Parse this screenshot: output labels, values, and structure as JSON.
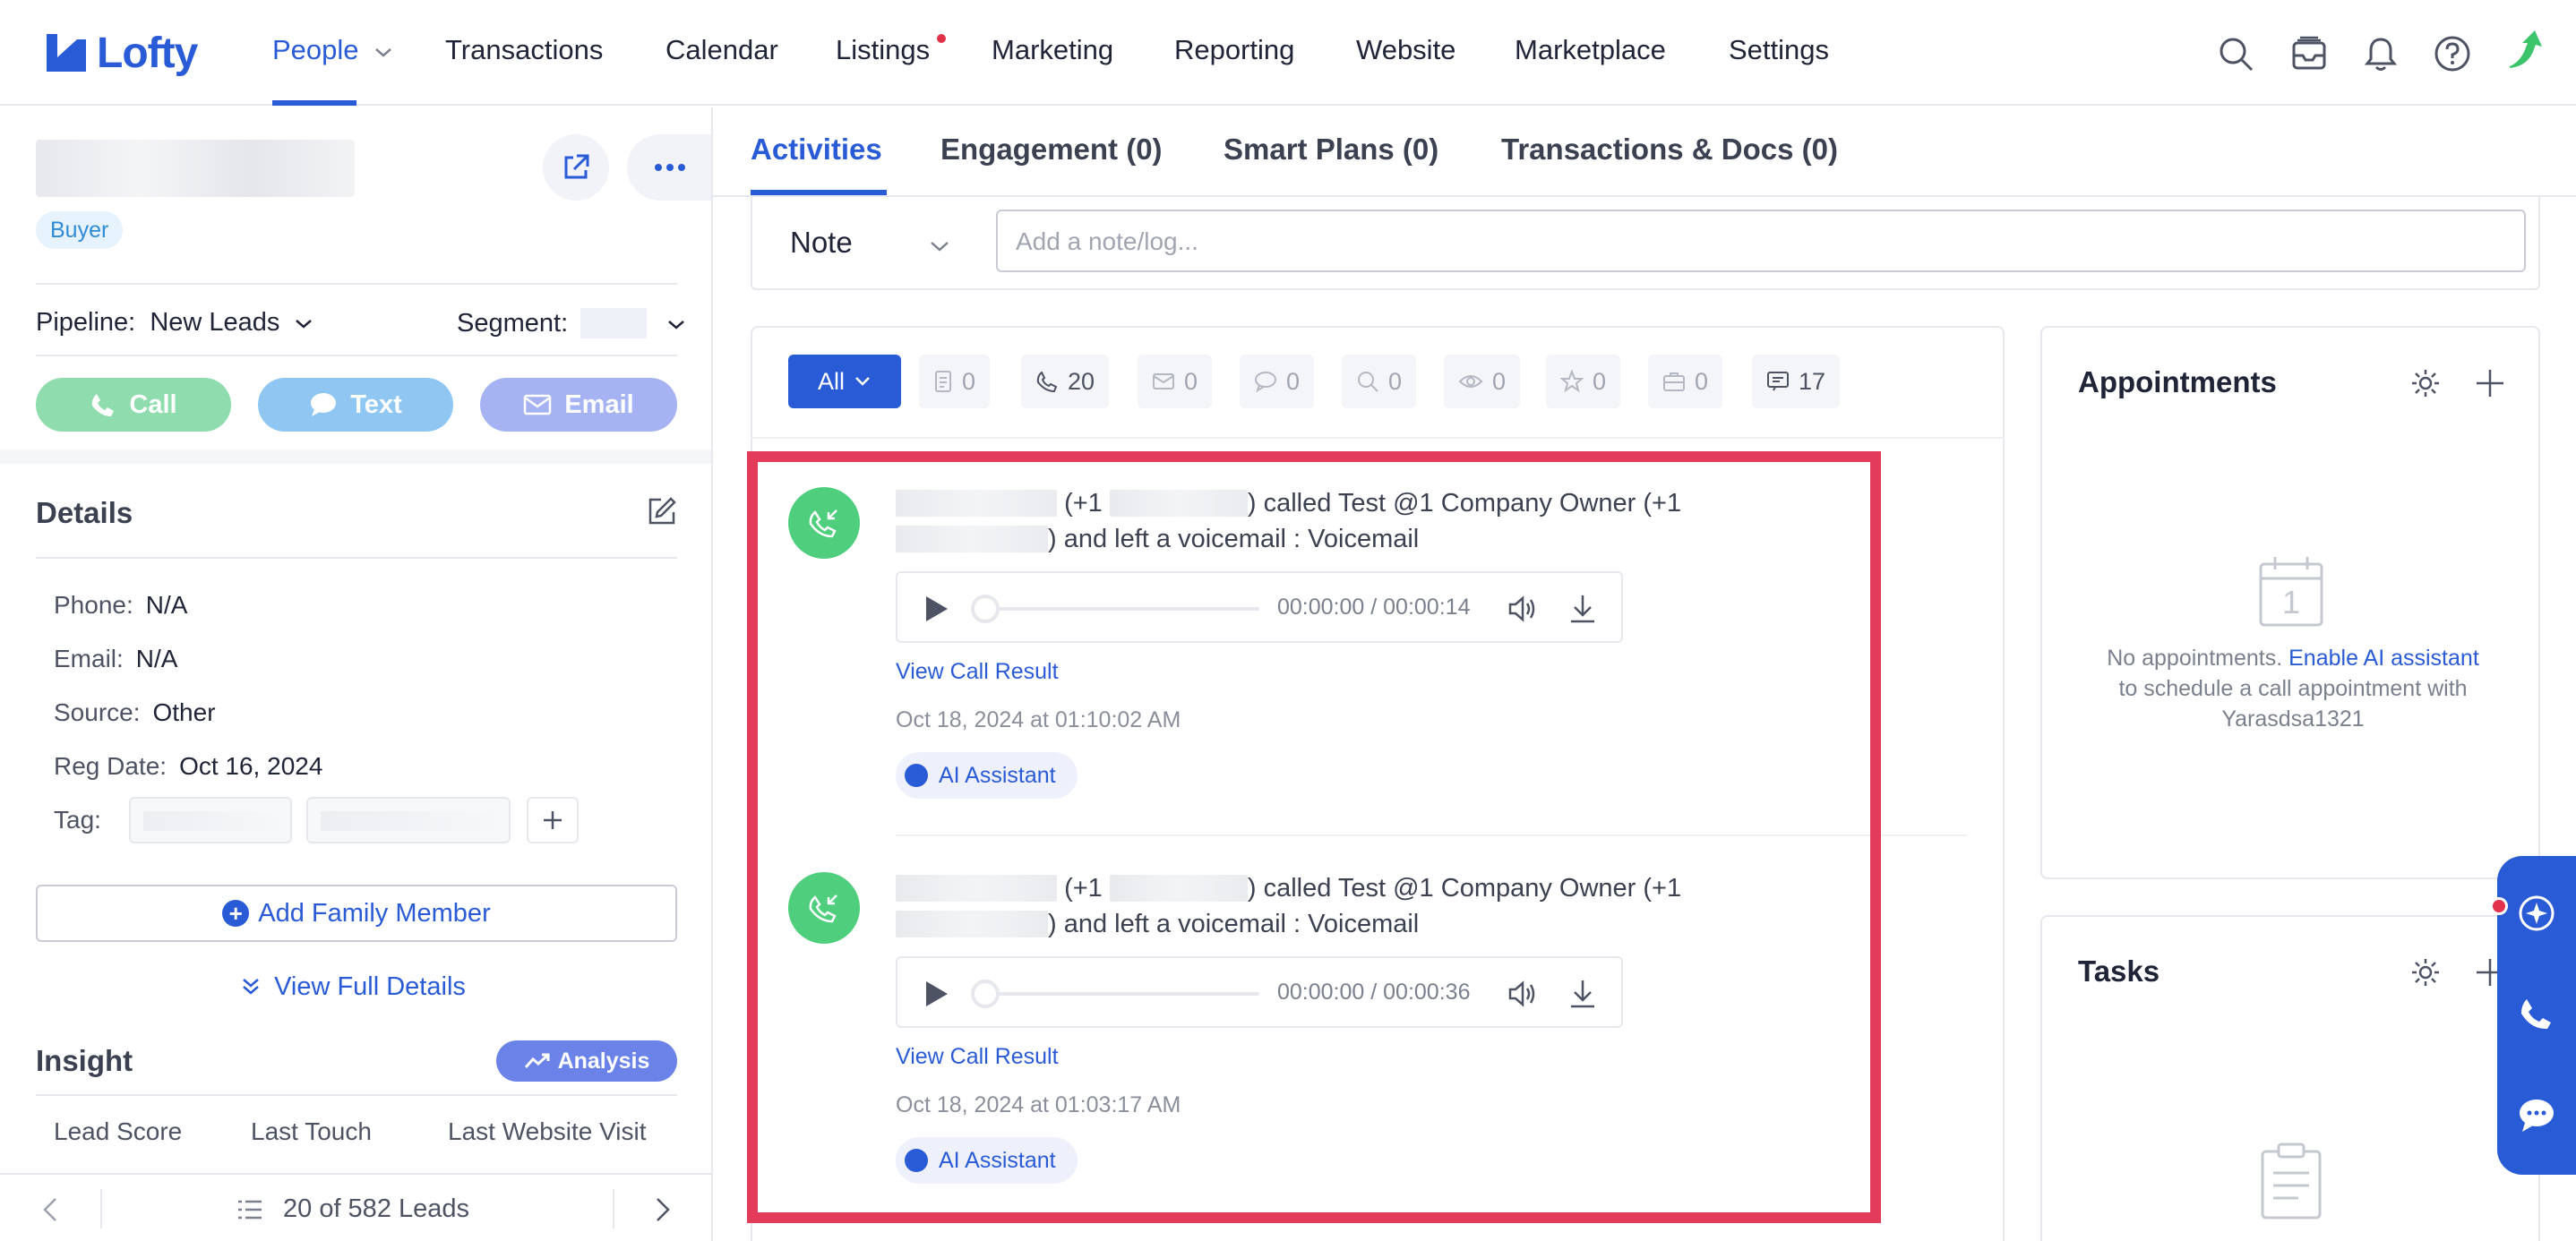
{
  "app": {
    "logo_text": "Lofty"
  },
  "nav": {
    "items": [
      "People",
      "Transactions",
      "Calendar",
      "Listings",
      "Marketing",
      "Reporting",
      "Website",
      "Marketplace",
      "Settings"
    ],
    "active": "People"
  },
  "lead": {
    "role_tag": "Buyer",
    "pipeline_label": "Pipeline:",
    "pipeline_value": "New Leads",
    "segment_label": "Segment:",
    "call_label": "Call",
    "text_label": "Text",
    "email_label": "Email"
  },
  "details": {
    "title": "Details",
    "phone_label": "Phone:",
    "phone_value": "N/A",
    "email_label": "Email:",
    "email_value": "N/A",
    "source_label": "Source:",
    "source_value": "Other",
    "reg_label": "Reg Date:",
    "reg_value": "Oct 16, 2024",
    "tag_label": "Tag:",
    "add_family": "Add Family Member",
    "view_full": "View Full Details"
  },
  "insight": {
    "title": "Insight",
    "analysis": "Analysis",
    "col1": "Lead Score",
    "col2": "Last Touch",
    "col3": "Last Website Visit"
  },
  "pager": {
    "text": "20 of 582 Leads"
  },
  "tabs": [
    "Activities",
    "Engagement (0)",
    "Smart Plans (0)",
    "Transactions & Docs (0)"
  ],
  "note": {
    "type": "Note",
    "placeholder": "Add a note/log..."
  },
  "filters": {
    "all": "All",
    "counts": [
      "0",
      "20",
      "0",
      "0",
      "0",
      "0",
      "0",
      "0",
      "17"
    ]
  },
  "activities": [
    {
      "prefix": "(+1",
      "middle": ") called Test @1 Company Owner (+1",
      "line2": ") and left a voicemail : Voicemail",
      "time": "00:00:00 / 00:00:14",
      "link": "View Call Result",
      "timestamp": "Oct 18, 2024 at 01:10:02 AM",
      "badge": "AI Assistant"
    },
    {
      "prefix": "(+1",
      "middle": ") called Test @1 Company Owner (+1",
      "line2": ") and left a voicemail : Voicemail",
      "time": "00:00:00 / 00:00:36",
      "link": "View Call Result",
      "timestamp": "Oct 18, 2024 at 01:03:17 AM",
      "badge": "AI Assistant"
    }
  ],
  "appointments": {
    "title": "Appointments",
    "calendar_day": "1",
    "msg_pre": "No appointments.",
    "msg_link": "Enable AI assistant",
    "msg_post": "to schedule a call appointment with Yarasdsa1321"
  },
  "tasks": {
    "title": "Tasks"
  },
  "colors": {
    "brand": "#2a5bd7",
    "call": "#4fcf7e",
    "highlight": "#e23c5a"
  }
}
